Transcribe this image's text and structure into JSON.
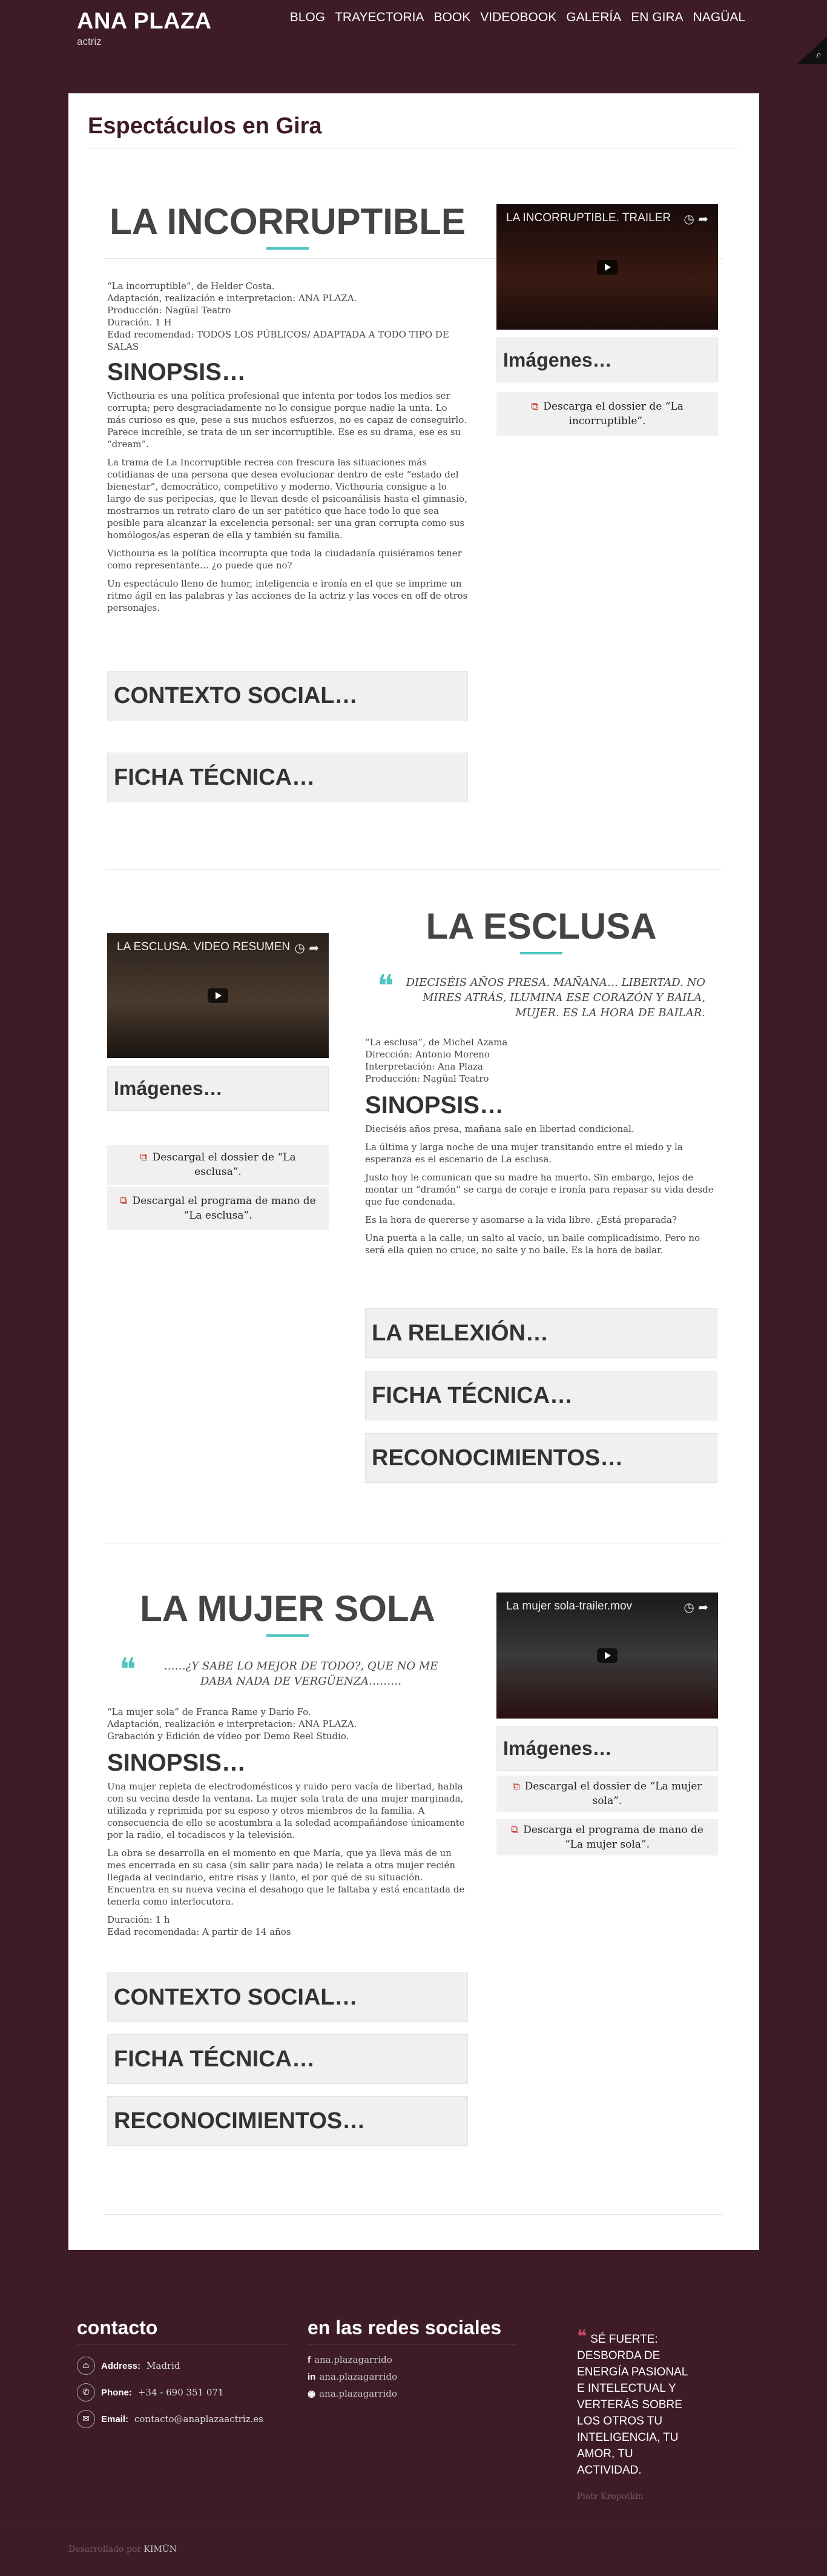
{
  "brand": {
    "title": "ANA PLAZA",
    "subtitle": "actriz"
  },
  "nav": [
    "BLOG",
    "TRAYECTORIA",
    "BOOK",
    "VIDEOBOOK",
    "GALERÍA",
    "EN GIRA",
    "NAGÜAL"
  ],
  "page": {
    "heading": "Espectáculos en Gira"
  },
  "shows": [
    {
      "title": "LA INCORRUPTIBLE",
      "credits": [
        "“La incorruptible”, de Helder Costa.",
        "Adaptación, realización e interpretacion: ANA PLAZA.",
        "Producción: Nagüal Teatro",
        "Duración. 1 H",
        "Edad recomendad: TODOS LOS PÚBLICOS/ ADAPTADA A TODO TIPO DE SALAS"
      ],
      "synopsis_heading": "SINOPSIS…",
      "synopsis": [
        "Victhouria es una política profesional que intenta por todos los medios ser corrupta; pero desgraciadamente no lo consigue porque nadie la unta. Lo más curioso es que, pese a sus muchos esfuerzos, no es capaz de conseguirlo. Parece increíble, se trata de un ser incorruptible. Ese es su drama, ese es su “dream”.",
        "La trama de La Incorruptible recrea con frescura las situaciones más cotidianas de una persona que desea evolucionar dentro de este “estado del bienestar”, democrático, competitivo y moderno. Victhouria consigue a lo largo de sus peripecias, que le llevan desde el psicoanálisis hasta el gimnasio, mostrarnos un retrato claro de un ser patético que hace todo lo que sea posible para alcanzar la excelencia personal: ser una gran corrupta como sus homólogos/as esperan de ella y también su familia.",
        "Victhouria es la política incorrupta que toda la ciudadanía quisiéramos tener como representante… ¿o puede que no?",
        "Un espectáculo lleno de humor, inteligencia e ironía en el que se imprime un ritmo ágil en las palabras y las acciones de la actriz y las voces en off de otros personajes."
      ],
      "collapsibles": [
        "CONTEXTO SOCIAL…",
        "FICHA TÉCNICA…"
      ],
      "video_title": "LA INCORRUPTIBLE. TRAILER",
      "images_label": "Imágenes…",
      "downloads": [
        "Descarga el dossier de “La incorruptible”."
      ]
    },
    {
      "title": "LA ESCLUSA",
      "quote": "DIECISÉIS AÑOS PRESA. MAÑANA… LIBERTAD. NO MIRES ATRÁS, ILUMINA ESE CORAZÓN Y BAILA, MUJER. ES LA HORA DE BAILAR.",
      "credits": [
        "“La esclusa”, de Michel Azama",
        "Dirección: Antonio Moreno",
        "Interpretación: Ana Plaza",
        "Producción: Nagüal Teatro"
      ],
      "synopsis_heading": "SINOPSIS…",
      "synopsis": [
        "Dieciséis años presa, mañana sale en libertad condicional.",
        "La última y larga noche de una mujer transitando entre el miedo y la esperanza es el escenario de La esclusa.",
        "Justo hoy le comunican que su madre ha muerto. Sin embargo, lejos de montar un “dramón” se carga de coraje e ironía para repasar su vida desde que fue condenada.",
        "Es la hora de quererse y asomarse a la vida libre. ¿Está preparada?",
        "Una puerta a la calle, un salto al vacío, un baile complicadísimo. Pero no será ella quien no cruce, no salte y no baile. Es la hora de bailar."
      ],
      "collapsibles": [
        "LA RELEXIÓN…",
        "FICHA TÉCNICA…",
        "RECONOCIMIENTOS…"
      ],
      "video_title": "LA ESCLUSA. VIDEO RESUMEN",
      "images_label": "Imágenes…",
      "downloads": [
        "Descargal el dossier de “La esclusa”.",
        "Descargal el programa de mano de “La esclusa”."
      ]
    },
    {
      "title": "LA MUJER SOLA",
      "quote": "……¿Y SABE LO MEJOR DE TODO?, QUE NO ME DABA NADA DE VERGÜENZA………",
      "credits": [
        "“La mujer sola” de Franca Rame y Darío Fo.",
        "Adaptación, realización e interpretacion: ANA PLAZA.",
        "Grabación y Edición de vídeo por Demo Reel Studio."
      ],
      "synopsis_heading": "SINOPSIS…",
      "synopsis": [
        "Una mujer repleta de electrodomésticos y ruido pero vacía de libertad, habla con su vecina desde la ventana. La mujer sola trata de una mujer marginada, utilizada y reprimida por su esposo y otros miembros de la familia. A consecuencia de ello se acostumbra a la soledad acompañándose únicamente por la radio, el tocadiscos y la televisión.",
        "La obra se desarrolla en el momento en que María, que ya lleva más de un mes encerrada en su casa (sin salir para nada) le relata a otra mujer recién llegada al vecindario, entre risas y llanto, el por qué de su situación. Encuentra en su nueva vecina el desahogo que le faltaba y está encantada de tenerla como interlocutora.",
        "Duración: 1 h",
        "Edad recomendada: A partir de 14 años"
      ],
      "collapsibles": [
        "CONTEXTO SOCIAL…",
        "FICHA TÉCNICA…",
        "RECONOCIMIENTOS…"
      ],
      "video_title": "La mujer sola-trailer.mov",
      "images_label": "Imágenes…",
      "downloads": [
        "Descargal el dossier de “La mujer sola”.",
        "Descarga el programa de mano de “La mujer sola”."
      ]
    }
  ],
  "footer": {
    "contact_title": "contacto",
    "address_label": "Address:",
    "address": "Madrid",
    "phone_label": "Phone:",
    "phone": "+34 - 690 351 071",
    "email_label": "Email:",
    "email": "contacto@anaplazaactriz.es",
    "social_title": "en las redes sociales",
    "social": [
      {
        "icon": "f",
        "text": "ana.plazagarrido"
      },
      {
        "icon": "in",
        "text": "ana.plazagarrido"
      },
      {
        "icon": "◉",
        "text": "ana.plazagarrido"
      }
    ],
    "quote": "SÉ FUERTE: DESBORDA DE ENERGÍA PASIONAL E INTELECTUAL Y VERTERÁS SOBRE LOS OTROS TU INTELIGENCIA, TU AMOR, TU ACTIVIDAD.",
    "quote_author": "Piotr Kropotkin",
    "credit_prefix": "Desarrollado por",
    "credit_link": "KIMÜN"
  }
}
